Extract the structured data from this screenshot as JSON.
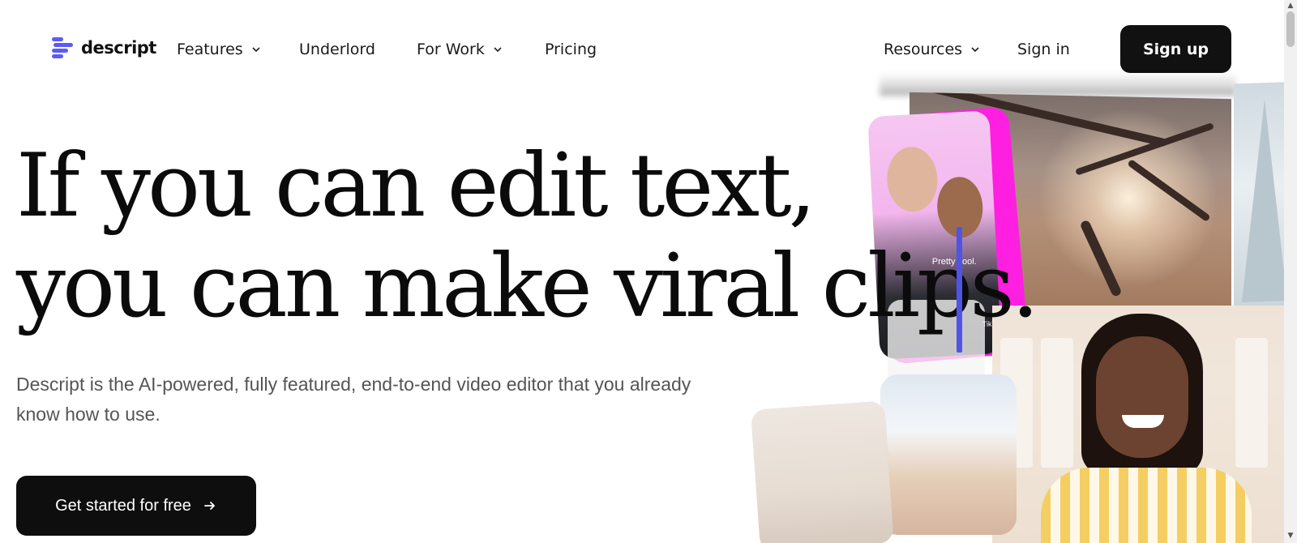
{
  "brand": {
    "name": "descript",
    "accent": "#5b5cf6"
  },
  "nav": {
    "features": "Features",
    "underlord": "Underlord",
    "for_work": "For Work",
    "pricing": "Pricing",
    "resources": "Resources",
    "sign_in": "Sign in",
    "sign_up": "Sign up"
  },
  "hero": {
    "headline_line1": "If you can edit text,",
    "headline_line2": "you can make viral clips.",
    "subtext": "Descript is the AI-powered, fully featured, end-to-end video editor that you already know how to use.",
    "cta": "Get started for free",
    "cursor_color": "#5054e6"
  },
  "collage": {
    "clip_caption": "Pretty cool.",
    "clip_watermark": "TikTok"
  },
  "icons": {
    "logo": "descript-logo-icon",
    "dropdown": "chevron-down-icon",
    "cta_arrow": "arrow-right-icon"
  }
}
